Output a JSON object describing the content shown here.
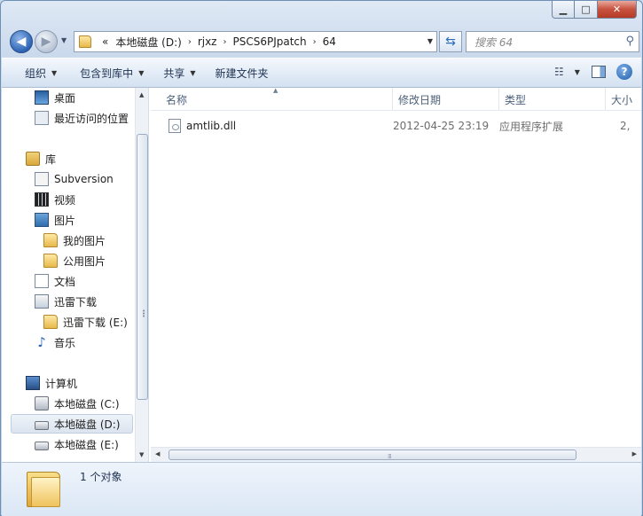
{
  "window": {
    "caption": {
      "minimize": "▁",
      "maximize": "□",
      "close": "✕"
    }
  },
  "navigation": {
    "back_icon": "back-arrow-icon",
    "forward_icon": "forward-arrow-icon",
    "breadcrumb": [
      "«",
      "本地磁盘 (D:)",
      "rjxz",
      "PSCS6PJpatch",
      "64"
    ],
    "search_placeholder": "搜索 64"
  },
  "toolbar": {
    "organize": "组织",
    "include_in_library": "包含到库中",
    "share": "共享",
    "new_folder": "新建文件夹"
  },
  "sidebar": {
    "favorites": [
      {
        "label": "桌面",
        "icon": "desktop-icon"
      },
      {
        "label": "最近访问的位置",
        "icon": "recent-places-icon"
      }
    ],
    "libraries_header": "库",
    "libraries": [
      {
        "label": "Subversion",
        "icon": "subversion-icon"
      },
      {
        "label": "视频",
        "icon": "video-icon"
      },
      {
        "label": "图片",
        "icon": "pictures-icon"
      },
      {
        "label": "我的图片",
        "icon": "folder-icon"
      },
      {
        "label": "公用图片",
        "icon": "folder-icon"
      },
      {
        "label": "文档",
        "icon": "documents-icon"
      },
      {
        "label": "迅雷下载",
        "icon": "download-icon"
      },
      {
        "label": "迅雷下载 (E:)",
        "icon": "folder-icon"
      },
      {
        "label": "音乐",
        "icon": "music-icon"
      }
    ],
    "computer_header": "计算机",
    "drives": [
      {
        "label": "本地磁盘 (C:)",
        "icon": "system-drive-icon"
      },
      {
        "label": "本地磁盘 (D:)",
        "icon": "drive-icon",
        "selected": true
      },
      {
        "label": "本地磁盘 (E:)",
        "icon": "drive-icon"
      }
    ]
  },
  "filelist": {
    "columns": [
      "名称",
      "修改日期",
      "类型",
      "大小"
    ],
    "rows": [
      {
        "name": "amtlib.dll",
        "modified": "2012-04-25 23:19",
        "type": "应用程序扩展",
        "size": "2,"
      }
    ]
  },
  "details": {
    "count": "1 个对象"
  }
}
